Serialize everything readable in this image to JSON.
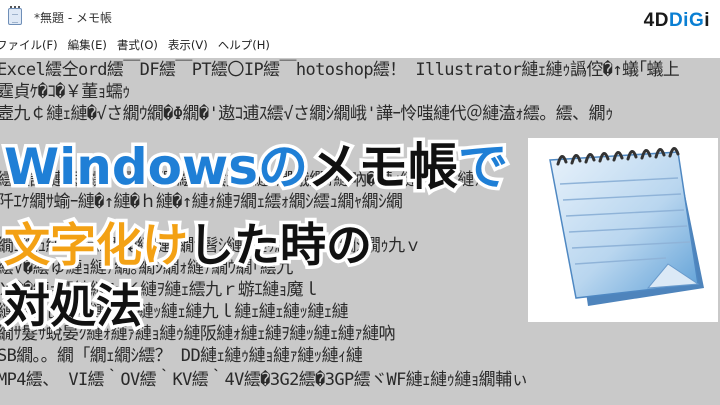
{
  "window": {
    "title": "*無題 - メモ帳"
  },
  "brand": {
    "prefix": "4D",
    "accent": "DiG",
    "suffix": "i"
  },
  "menu": [
    {
      "label": "ファイル(F)"
    },
    {
      "label": "編集(E)"
    },
    {
      "label": "書式(O)"
    },
    {
      "label": "表示(V)"
    },
    {
      "label": "ヘルプ(H)"
    }
  ],
  "editor": {
    "lines": [
      "Excel繧仝ord繧￣DF繧￣PT繧〇IP繧￣hotoshop繧！ Illustrator縺ｪ縺ｩ譌倥�↑蟻｢蟻上",
      "霆貞ｹ�ｺ�￥董ｮ蠕ｩ",
      "壼九￠縺ｪ縺�√さ繝ｳ繝�Φ繝�'遨ｺ逋ｽ繧√さ繝ｼ繝峨'譁ｰ怜嗤縺代＠縺溘ｫ繧。繧、繝ｩ",
      "",
      "",
      "繧呈譚縺医ｪ繧。繧、繝ｩ繧翫繧九↑縺ｧ繝峨繝ｫ縺吶�縺ｨ縺ｪ繧九縺ｧ",
      "阡ｴｹ繝ｻ蝓ｰ縺�↑縺�ｈ縺�↑縺ｫ縺ｦ繝ｪ繧ｫ繝ｼ繧ｭ繝ｬ繝ｼ繝",
      "",
      "繝ｪ繝ｭ縺ｫ縺ｪ繧翫�縺縺ｫ繝ｻ髫ｼ縺ｫ縺ｩ繧定ｩ繧ｭ繝ｼ繝ｩ九ｖ",
      "繧√�繧ゅ縺ｮ縺ｧ繝｡繝ｼ繝ｫ縺ｧ繝ｳ繝｢繧九",
      "Ｘ��縺ｮ繧鐃縺ｦ∞Ｋ縺ｦ縺ｪ繧九ｒ蝣ｴ縺ｮ魔ｌ",
      "縺ｧ繧九�縺ｮ縺ｫ縺ｧ縺ｯ縺ｪ縺九ｌ縺ｪ縺ｪ縺ｯ縺ｪ縺",
      "繝ｻ髮ｻ蛻晏ｸ縺ｫ縺ｧ縺ｮ縺ｩ縺阪縺ｫ縺ｪ縺ｦ縺ｯ縺ｪ縺ｧ縺吶",
      "SB繝｡。繝「繝ｪ繝ｼ繧？ DD縺ｪ縺ｩ縺ｮ縺ｧ縺ｯ縺ｨ縺",
      "MP4繧、 VI繧｀OV繧｀KV繧｀4V繧�3G2繧�3GP繧ヾWF縺ｪ縺ｩ縺ｮ繝輔ぃ"
    ]
  },
  "headline": {
    "line1_blue": "Windowsの",
    "line1_dark": "メモ帳",
    "line1_blue2": "で",
    "line2_orange": "文字化け",
    "line2_dark": "した時の",
    "line3": "対処法"
  }
}
